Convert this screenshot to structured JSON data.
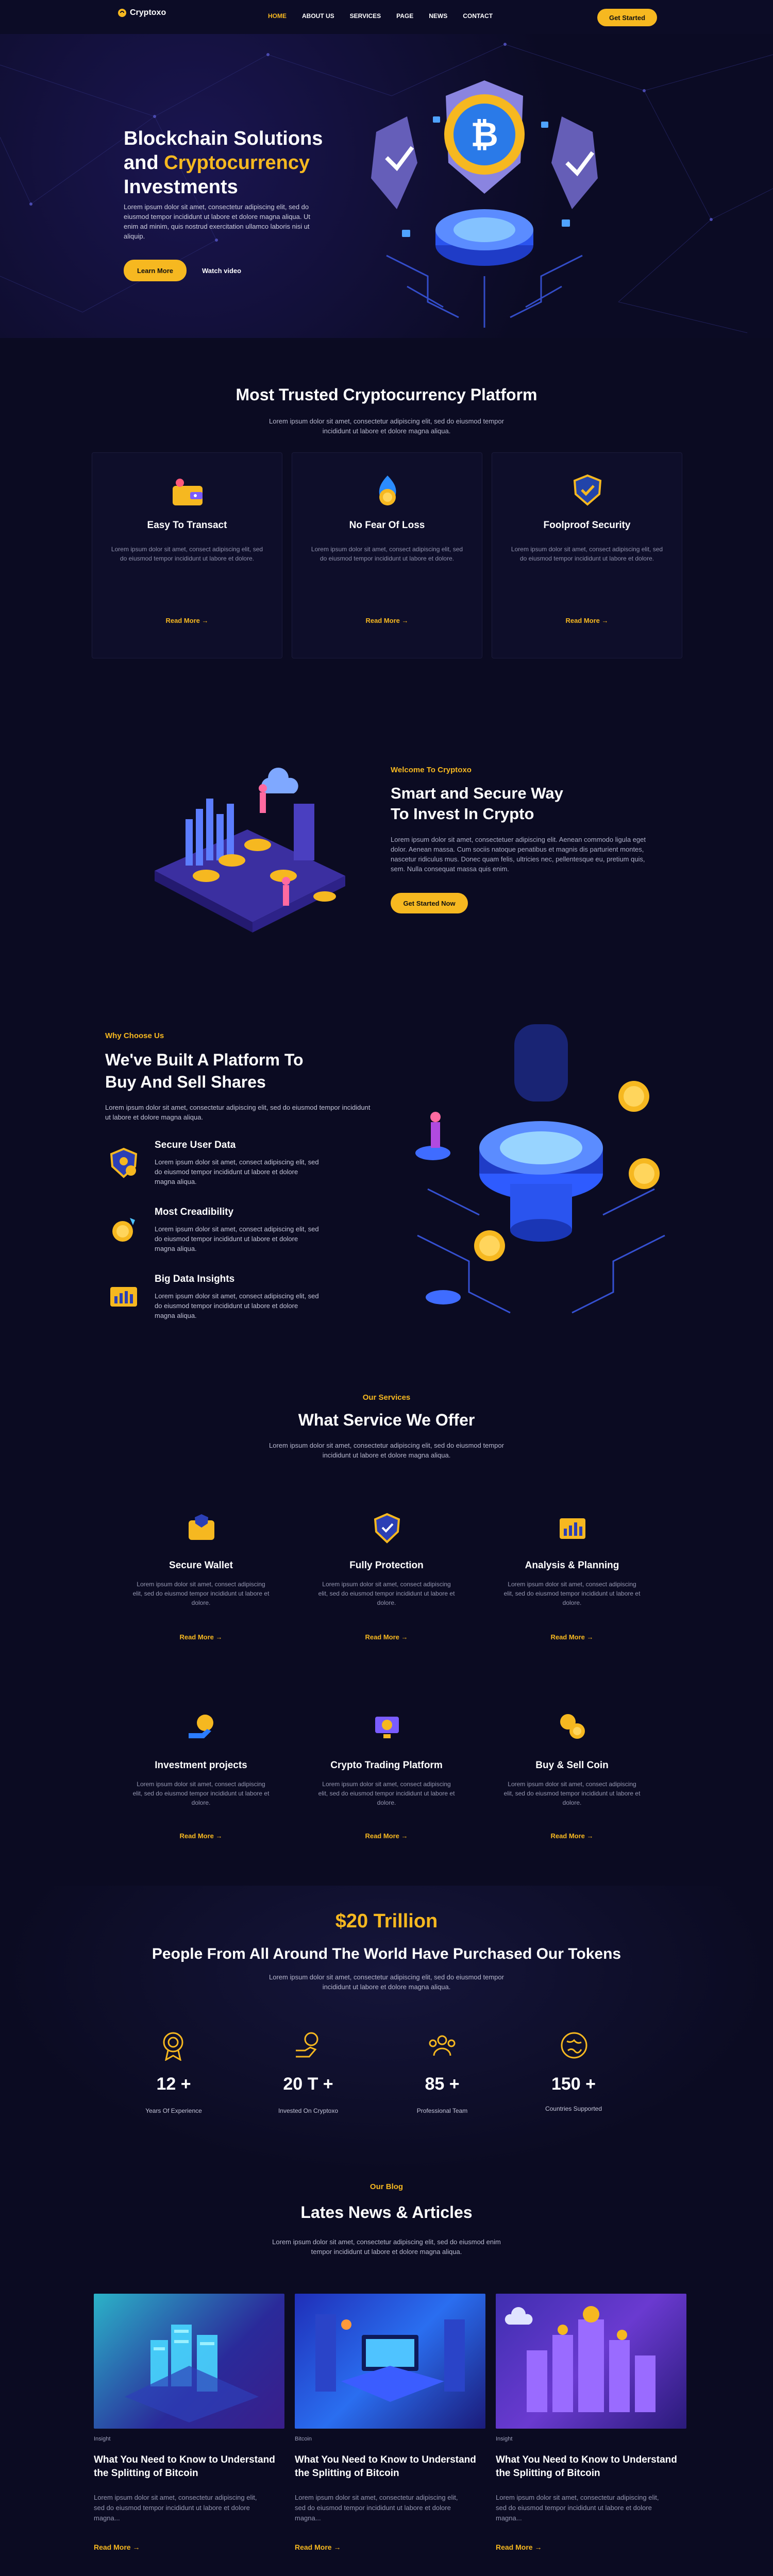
{
  "brand": {
    "name": "Cryptoxo",
    "accent": "#f6b820",
    "background": "#0b0b22"
  },
  "nav": {
    "items": [
      "HOME",
      "ABOUT US",
      "SERVICES",
      "PAGE",
      "NEWS",
      "CONTACT"
    ],
    "active": "HOME",
    "cta": "Get Started"
  },
  "hero": {
    "title_line1": "Blockchain Solutions",
    "title_and": "and ",
    "title_highlight": "Cryptocurrency",
    "title_line3": "Investments",
    "text": "Lorem ipsum dolor sit amet, consectetur adipiscing elit, sed do eiusmod tempor incididunt ut labore et dolore magna aliqua. Ut enim ad minim, quis nostrud exercitation ullamco laboris nisi ut aliquip.",
    "primary_button": "Learn More",
    "secondary_button": "Watch video"
  },
  "trusted": {
    "title": "Most Trusted Cryptocurrency Platform",
    "subtitle": "Lorem ipsum dolor sit amet, consectetur adipiscing elit, sed do eiusmod tempor incididunt ut labore et dolore magna aliqua.",
    "cards": [
      {
        "icon": "wallet-icon",
        "title": "Easy To Transact",
        "text": "Lorem ipsum dolor sit amet, consect adipiscing elit, sed do eiusmod tempor incididunt ut labore et dolore.",
        "more": "Read More"
      },
      {
        "icon": "fire-coin-icon",
        "title": "No Fear Of Loss",
        "text": "Lorem ipsum dolor sit amet, consect adipiscing elit, sed do eiusmod tempor incididunt ut labore et dolore.",
        "more": "Read More"
      },
      {
        "icon": "shield-check-icon",
        "title": "Foolproof Security",
        "text": "Lorem ipsum dolor sit amet, consect adipiscing elit, sed do eiusmod tempor incididunt ut labore et dolore.",
        "more": "Read More"
      }
    ]
  },
  "welcome": {
    "kicker": "Welcome To Cryptoxo",
    "title_line1": "Smart and Secure Way",
    "title_line2": "To Invest In Crypto",
    "text": "Lorem ipsum dolor sit amet, consectetuer adipiscing elit. Aenean commodo ligula eget dolor. Aenean massa. Cum sociis natoque penatibus et magnis dis parturient montes, nascetur ridiculus mus. Donec quam felis, ultricies nec, pellentesque eu, pretium quis, sem. Nulla consequat massa quis enim.",
    "button": "Get Started Now"
  },
  "why": {
    "kicker": "Why Choose Us",
    "title_line1": "We've Built A Platform To",
    "title_line2": "Buy And Sell Shares",
    "text": "Lorem ipsum dolor sit amet, consectetur adipiscing elit, sed do eiusmod tempor incididunt ut labore et dolore magna aliqua.",
    "features": [
      {
        "icon": "secure-user-icon",
        "title": "Secure User Data",
        "text": "Lorem ipsum dolor sit amet, consect adipiscing elit, sed do eiusmod tempor incididunt ut labore et dolore magna aliqua."
      },
      {
        "icon": "medal-icon",
        "title": "Most Creadibility",
        "text": "Lorem ipsum dolor sit amet, consect adipiscing elit, sed do eiusmod tempor incididunt ut labore et dolore magna aliqua."
      },
      {
        "icon": "chart-card-icon",
        "title": "Big Data Insights",
        "text": "Lorem ipsum dolor sit amet, consect adipiscing elit, sed do eiusmod tempor incididunt ut labore et dolore magna aliqua."
      }
    ]
  },
  "services": {
    "kicker": "Our Services",
    "title": "What Service We Offer",
    "subtitle": "Lorem ipsum dolor sit amet, consectetur adipiscing elit, sed do eiusmod tempor incididunt ut labore et dolore magna aliqua.",
    "items": [
      {
        "icon": "secure-wallet-icon",
        "title": "Secure Wallet",
        "text": "Lorem ipsum dolor sit amet, consect adipiscing elit, sed do eiusmod tempor incididunt ut labore et dolore.",
        "more": "Read More"
      },
      {
        "icon": "shield-icon",
        "title": "Fully Protection",
        "text": "Lorem ipsum dolor sit amet, consect adipiscing elit, sed do eiusmod tempor incididunt ut labore et dolore.",
        "more": "Read More"
      },
      {
        "icon": "analysis-icon",
        "title": "Analysis & Planning",
        "text": "Lorem ipsum dolor sit amet, consect adipiscing elit, sed do eiusmod tempor incididunt ut labore et dolore.",
        "more": "Read More"
      },
      {
        "icon": "investment-icon",
        "title": "Investment projects",
        "text": "Lorem ipsum dolor sit amet, consect adipiscing elit, sed do eiusmod tempor incididunt ut labore et dolore.",
        "more": "Read More"
      },
      {
        "icon": "trading-platform-icon",
        "title": "Crypto Trading Platform",
        "text": "Lorem ipsum dolor sit amet, consect adipiscing elit, sed do eiusmod tempor incididunt ut labore et dolore.",
        "more": "Read More"
      },
      {
        "icon": "coins-icon",
        "title": "Buy & Sell Coin",
        "text": "Lorem ipsum dolor sit amet, consect adipiscing elit, sed do eiusmod tempor incididunt ut labore et dolore.",
        "more": "Read More"
      }
    ]
  },
  "tokens": {
    "amount": "$20 Trillion",
    "title": "People From All Around The World Have Purchased Our Tokens",
    "subtitle": "Lorem ipsum dolor sit amet, consectetur adipiscing elit, sed do eiusmod tempor incididunt ut labore et dolore magna aliqua.",
    "stats": [
      {
        "icon": "award-icon",
        "value": "12 +",
        "label": "Years Of Experience"
      },
      {
        "icon": "invest-hand-icon",
        "value": "20 T +",
        "label": "Invested On Cryptoxo"
      },
      {
        "icon": "team-icon",
        "value": "85 +",
        "label": "Professional Team"
      },
      {
        "icon": "globe-icon",
        "value": "150 +",
        "label": "Countries Supported"
      }
    ]
  },
  "blog": {
    "kicker": "Our Blog",
    "title": "Lates News & Articles",
    "subtitle": "Lorem ipsum dolor sit amet, consectetur adipiscing elit, sed do eiusmod enim tempor incididunt ut labore et dolore magna aliqua.",
    "posts": [
      {
        "tag": "Insight",
        "title": "What You Need to Know to Understand the Splitting of Bitcoin",
        "text": "Lorem ipsum dolor sit amet, consectetur adipiscing elit, sed do eiusmod tempor incididunt ut labore et dolore magna...",
        "more": "Read More"
      },
      {
        "tag": "Bitcoin",
        "title": "What You Need to Know to Understand the Splitting of Bitcoin",
        "text": "Lorem ipsum dolor sit amet, consectetur adipiscing elit, sed do eiusmod tempor incididunt ut labore et dolore magna...",
        "more": "Read More"
      },
      {
        "tag": "Insight",
        "title": "What You Need to Know to Understand the Splitting of Bitcoin",
        "text": "Lorem ipsum dolor sit amet, consectetur adipiscing elit, sed do eiusmod tempor incididunt ut labore et dolore magna...",
        "more": "Read More"
      }
    ]
  }
}
